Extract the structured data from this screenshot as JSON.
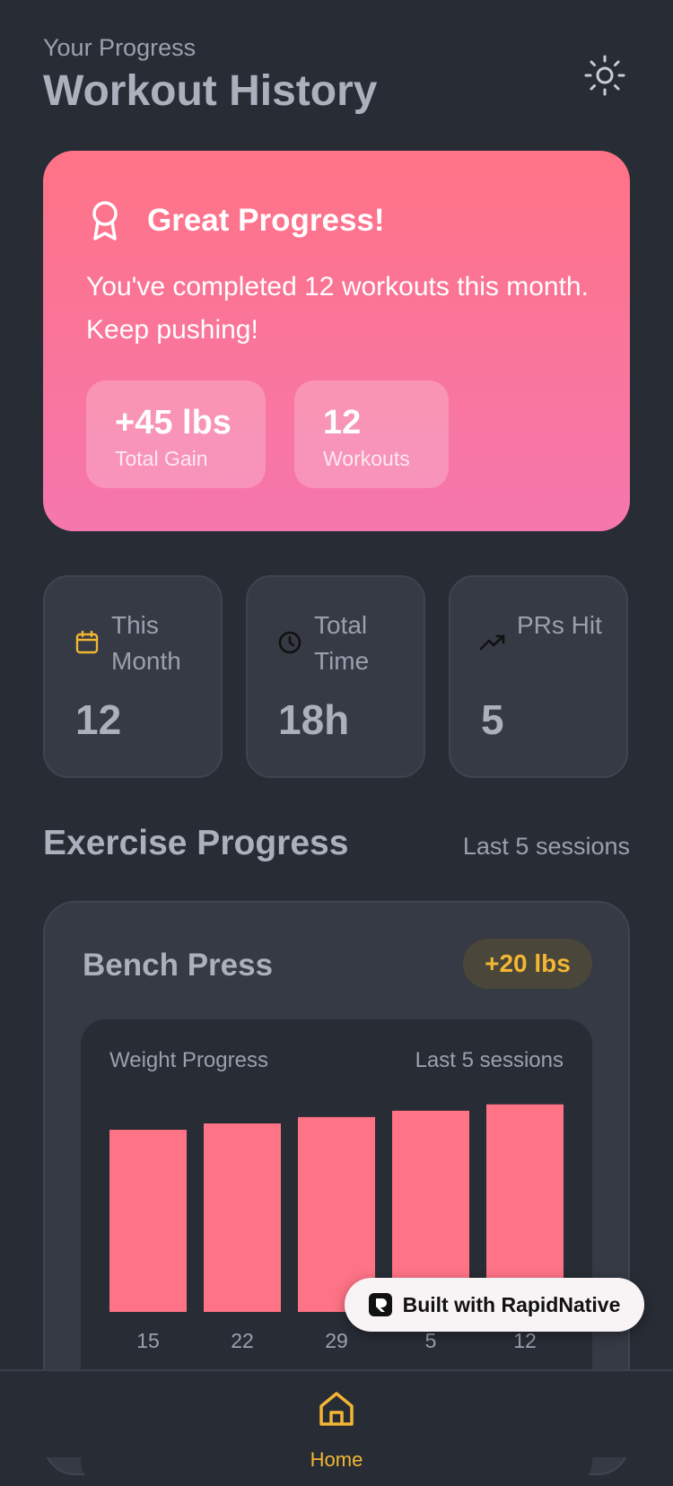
{
  "header": {
    "subtitle": "Your Progress",
    "title": "Workout History"
  },
  "hero": {
    "title": "Great Progress!",
    "message": "You've completed 12 workouts this month. Keep pushing!",
    "pills": [
      {
        "value": "+45 lbs",
        "label": "Total Gain"
      },
      {
        "value": "12",
        "label": "Workouts"
      }
    ]
  },
  "stats": [
    {
      "label": "This Month",
      "value": "12",
      "icon": "calendar-icon"
    },
    {
      "label": "Total Time",
      "value": "18h",
      "icon": "clock-icon"
    },
    {
      "label": "PRs Hit",
      "value": "5",
      "icon": "trending-up-icon"
    }
  ],
  "section": {
    "title": "Exercise Progress",
    "subtitle": "Last 5 sessions"
  },
  "exercise": {
    "name": "Bench Press",
    "badge": "+20 lbs",
    "chart_label": "Weight Progress",
    "chart_sub": "Last 5 sessions"
  },
  "chart_data": {
    "type": "bar",
    "categories": [
      "15",
      "22",
      "29",
      "5",
      "12"
    ],
    "values": [
      0.86,
      0.89,
      0.92,
      0.95,
      0.98
    ],
    "ylim": [
      0,
      1
    ],
    "grid": false,
    "color": "#fe7386"
  },
  "badge": {
    "text": "Built with RapidNative"
  },
  "nav": {
    "home_label": "Home"
  },
  "colors": {
    "accent": "#f3b634",
    "hero_top": "#fe7386",
    "hero_bottom": "#f577ad",
    "background": "#282c35"
  }
}
